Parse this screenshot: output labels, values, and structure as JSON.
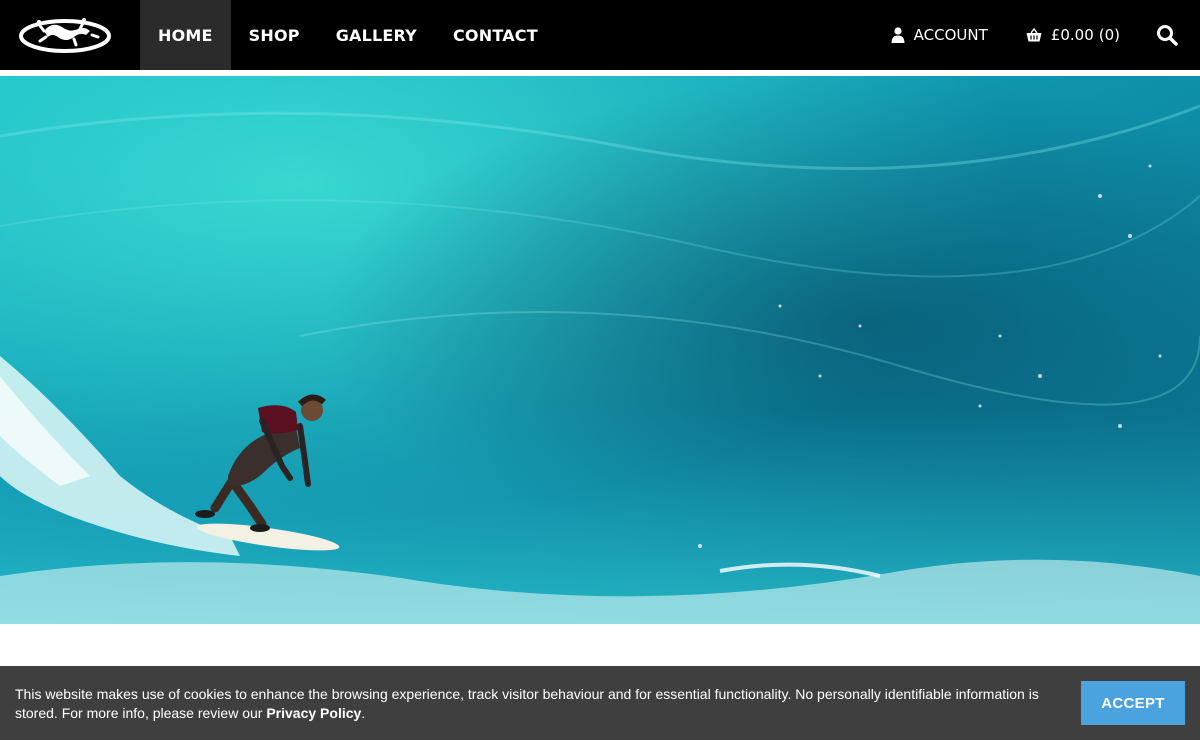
{
  "header": {
    "nav": [
      {
        "label": "HOME",
        "active": true
      },
      {
        "label": "SHOP",
        "active": false
      },
      {
        "label": "GALLERY",
        "active": false
      },
      {
        "label": "CONTACT",
        "active": false
      }
    ],
    "account_label": "ACCOUNT",
    "cart_total": "£0.00",
    "cart_count": "(0)",
    "icons": {
      "logo": "gecko-logo-icon",
      "account": "user-icon",
      "cart": "basket-icon",
      "search": "search-icon"
    }
  },
  "hero": {
    "image": "surfer-riding-turquoise-wave"
  },
  "cookie_bar": {
    "text": "This website makes use of cookies to enhance the browsing experience, track visitor behaviour and for essential functionality. No personally identifiable information is stored. For more info, please review our ",
    "link": "Privacy Policy",
    "suffix": ".",
    "accept_label": "ACCEPT"
  },
  "colors": {
    "header_bg": "#000000",
    "nav_active_bg": "#2b2b2b",
    "cookie_bg": "#3f3f3f",
    "accept_bg": "#4aa3df",
    "wave_dark": "#0a6b88",
    "wave_light": "#2fd2d0"
  }
}
